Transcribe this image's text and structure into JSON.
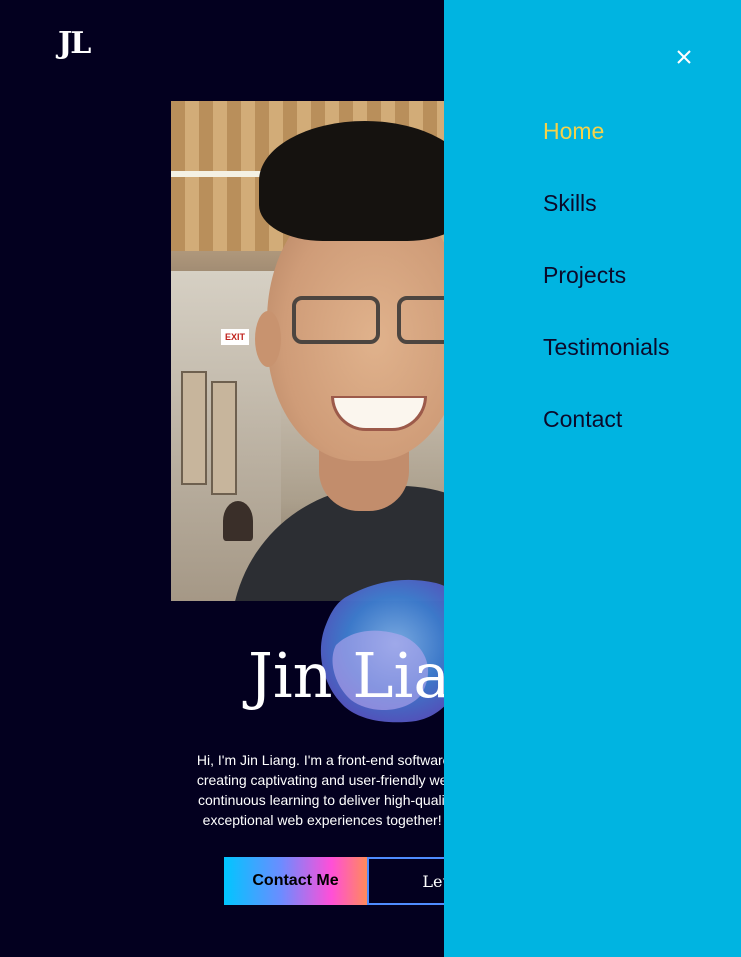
{
  "header": {
    "logo": "JL"
  },
  "hero": {
    "name": "Jin Liang",
    "intro_lines": [
      "Hi, I'm Jin Liang. I'm a front-end software engineer base",
      "creating captivating and user-friendly web interfaces. I p",
      "continuous learning to deliver high-quality solutions that",
      "exceptional web experiences together! Apart from that"
    ],
    "buttons": {
      "contact": "Contact Me",
      "talk": "Let's"
    },
    "portrait_sign": "EXIT"
  },
  "drawer": {
    "close_icon": "close-icon",
    "items": [
      {
        "label": "Home",
        "active": true
      },
      {
        "label": "Skills",
        "active": false
      },
      {
        "label": "Projects",
        "active": false
      },
      {
        "label": "Testimonials",
        "active": false
      },
      {
        "label": "Contact",
        "active": false
      }
    ]
  },
  "colors": {
    "page_bg": "#03001f",
    "drawer_bg": "#00b4e1",
    "active_nav": "#f5d24a",
    "nav_text": "#0b0a2a"
  }
}
